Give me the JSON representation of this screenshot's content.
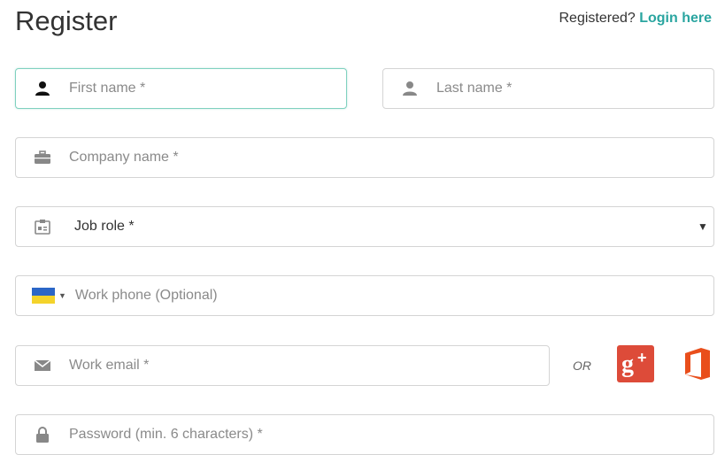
{
  "header": {
    "title": "Register",
    "registered_text": "Registered?",
    "login_link": "Login here"
  },
  "form": {
    "first_name_placeholder": "First name *",
    "last_name_placeholder": "Last name *",
    "company_placeholder": "Company name *",
    "job_role_value": "Job role *",
    "phone_placeholder": "Work phone (Optional)",
    "email_placeholder": "Work email *",
    "password_placeholder": "Password (min. 6 characters) *"
  },
  "social": {
    "or_text": "OR",
    "google_icon": "google-plus-icon",
    "office_icon": "office-icon"
  },
  "colors": {
    "accent": "#2aa5a0",
    "focus_border": "#7fd1bf",
    "google_red": "#dd4b39",
    "office_orange": "#e94e1b",
    "flag_blue": "#2b66c7",
    "flag_yellow": "#f4d32b"
  }
}
